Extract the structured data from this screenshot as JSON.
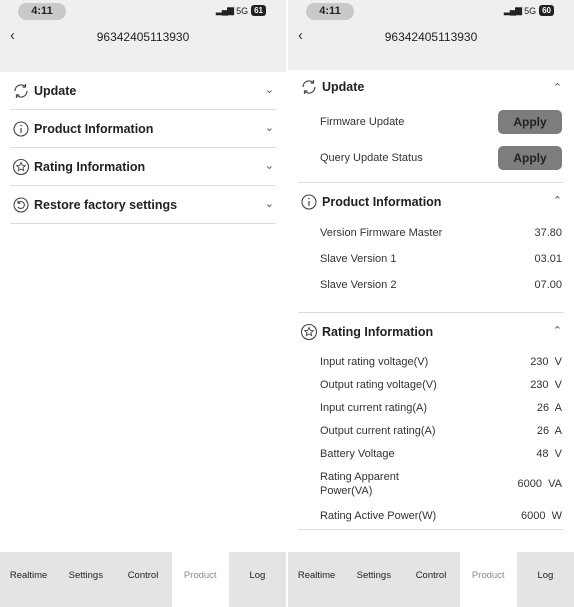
{
  "left": {
    "status": {
      "time": "4:11",
      "network": "5G",
      "battery": "61"
    },
    "header": {
      "back_icon": "chevron-left-icon",
      "title": "96342405113930"
    },
    "sections": [
      {
        "label": "Update",
        "icon": "refresh-icon",
        "chevron": "chevron-down-icon"
      },
      {
        "label": "Product Information",
        "icon": "info-icon",
        "chevron": "chevron-down-icon"
      },
      {
        "label": "Rating Information",
        "icon": "star-icon",
        "chevron": "chevron-down-icon"
      },
      {
        "label": "Restore factory settings",
        "icon": "restore-icon",
        "chevron": "chevron-down-icon"
      }
    ],
    "tabs": [
      "Realtime",
      "Settings",
      "Control",
      "Product",
      "Log"
    ],
    "active_tab": "Product"
  },
  "right": {
    "status": {
      "time": "4:11",
      "network": "5G",
      "battery": "60"
    },
    "header": {
      "title": "96342405113930"
    },
    "update": {
      "label": "Update",
      "rows": [
        {
          "label": "Firmware Update",
          "button": "Apply"
        },
        {
          "label": "Query Update Status",
          "button": "Apply"
        }
      ]
    },
    "product": {
      "label": "Product Information",
      "rows": [
        {
          "label": "Version Firmware Master",
          "value": "37.80"
        },
        {
          "label": "Slave Version 1",
          "value": "03.01"
        },
        {
          "label": "Slave Version 2",
          "value": "07.00"
        }
      ]
    },
    "rating": {
      "label": "Rating Information",
      "rows": [
        {
          "label": "Input rating voltage(V)",
          "value": "230  V"
        },
        {
          "label": "Output rating voltage(V)",
          "value": "230  V"
        },
        {
          "label": "Input current rating(A)",
          "value": "26  A"
        },
        {
          "label": "Output current rating(A)",
          "value": "26  A"
        },
        {
          "label": "Battery Voltage",
          "value": "48  V"
        },
        {
          "label": "Rating Apparent Power(VA)",
          "value": "6000  VA"
        },
        {
          "label": "Rating Active Power(W)",
          "value": "6000  W"
        }
      ]
    },
    "tabs": [
      "Realtime",
      "Settings",
      "Control",
      "Product",
      "Log"
    ],
    "active_tab": "Product"
  },
  "colors": {
    "screen_bg": "#efefef",
    "content_bg": "#ffffff",
    "button_bg": "#7d7d7d",
    "tab_bar": "#e4e4e4",
    "active_tab_text": "#8a8a8a"
  }
}
